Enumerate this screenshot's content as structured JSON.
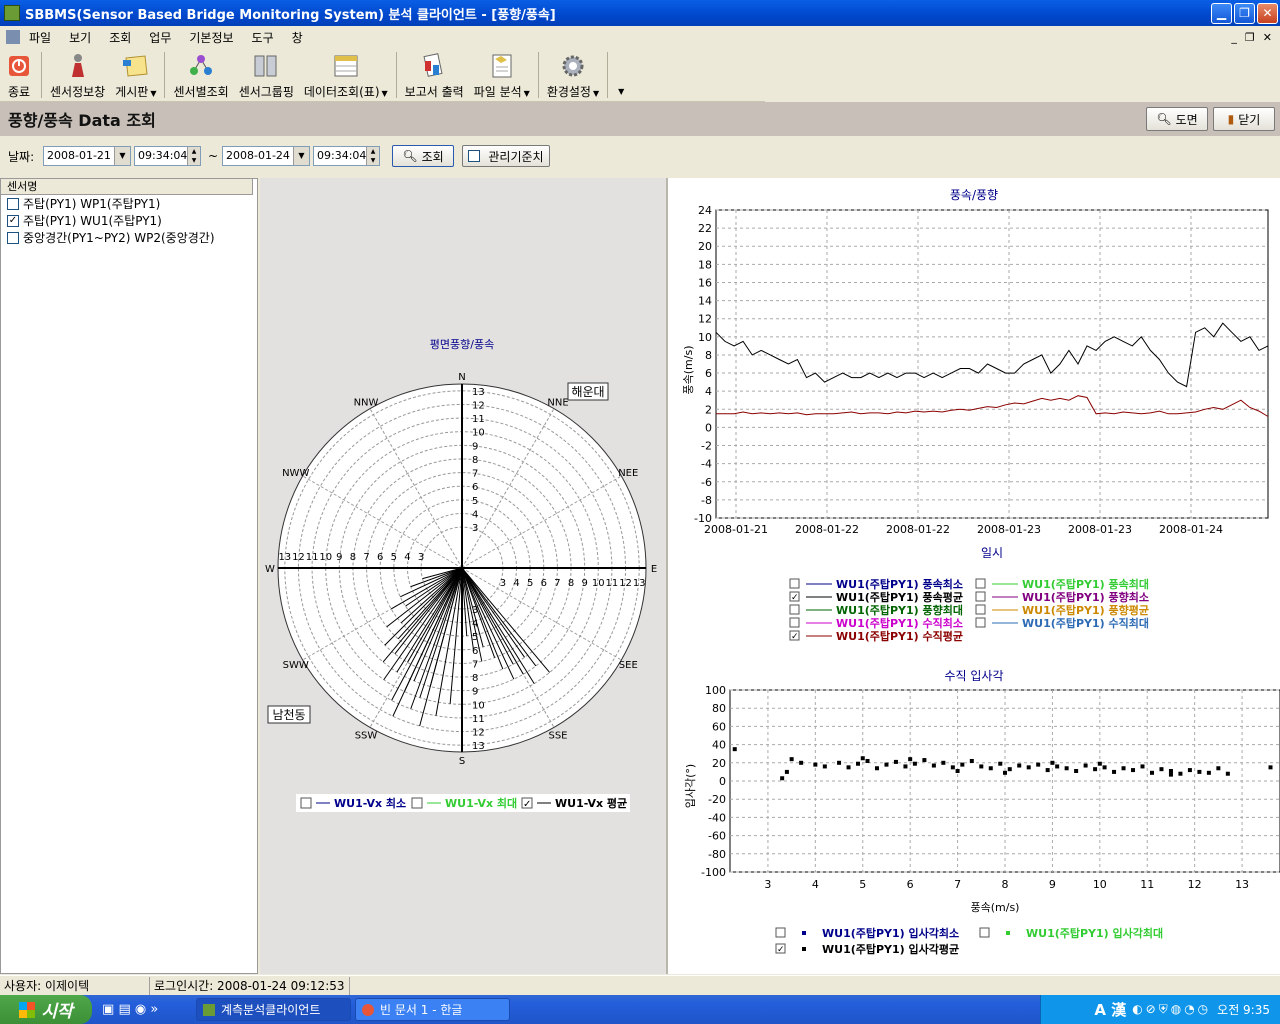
{
  "window": {
    "title": "SBBMS(Sensor Based Bridge Monitoring System) 분석 클라이언트 - [풍향/풍속]"
  },
  "menu": [
    "파일",
    "보기",
    "조회",
    "업무",
    "기본정보",
    "도구",
    "창"
  ],
  "toolbar": {
    "exit": "종료",
    "sensor_info": "센서정보창",
    "board": "게시판",
    "sensor_query": "센서별조회",
    "sensor_group": "센서그룹핑",
    "data_table": "데이터조회(표)",
    "report": "보고서 출력",
    "file_analysis": "파일 분석",
    "settings": "환경설정"
  },
  "page": {
    "title": "풍향/풍속 Data 조회",
    "map_btn": "도면",
    "close_btn": "닫기"
  },
  "filter": {
    "date_label": "날짜:",
    "start_date": "2008-01-21",
    "start_time": "09:34:04",
    "tilde": "~",
    "end_date": "2008-01-24",
    "end_time": "09:34:04",
    "query_btn": "조회",
    "mgmt_label": "관리기준치"
  },
  "sensors": {
    "header": "센서명",
    "items": [
      {
        "label": "주탑(PY1) WP1(주탑PY1)",
        "checked": false
      },
      {
        "label": "주탑(PY1) WU1(주탑PY1)",
        "checked": true
      },
      {
        "label": "중앙경간(PY1~PY2) WP2(중앙경간)",
        "checked": false
      }
    ]
  },
  "polar": {
    "title": "평면풍향/풍속",
    "directions": [
      "N",
      "NNE",
      "NEE",
      "E",
      "SEE",
      "SSE",
      "S",
      "SSW",
      "SWW",
      "W",
      "NWW",
      "NNW"
    ],
    "ring_labels": [
      "3",
      "4",
      "5",
      "6",
      "7",
      "8",
      "9",
      "10",
      "11",
      "12",
      "13"
    ],
    "annotations": [
      "해운대",
      "남천동"
    ],
    "legend": [
      {
        "label": "WU1-Vx 최소",
        "checked": false,
        "color": "#00008B"
      },
      {
        "label": "WU1-Vx 최대",
        "checked": false,
        "color": "#33CC33"
      },
      {
        "label": "WU1-Vx 평균",
        "checked": true,
        "color": "#000000"
      }
    ]
  },
  "chart_data": [
    {
      "type": "line",
      "title": "풍속/풍향",
      "xlabel": "일시",
      "ylabel": "풍속(m/s)",
      "ylim": [
        -10,
        24
      ],
      "y_ticks": [
        "24",
        "22",
        "20",
        "18",
        "16",
        "14",
        "12",
        "10",
        "8",
        "6",
        "4",
        "2",
        "0",
        "-2",
        "-4",
        "-6",
        "-8",
        "-10"
      ],
      "x_tick_labels": [
        "2008-01-21",
        "2008-01-22",
        "2008-01-22",
        "2008-01-23",
        "2008-01-23",
        "2008-01-24"
      ],
      "grid": true,
      "series": [
        {
          "name": "WU1(주탑PY1) 풍속평균",
          "color": "#000000",
          "values": [
            10.5,
            9.5,
            9.0,
            9.5,
            8.0,
            8.5,
            8.0,
            7.5,
            7.0,
            7.5,
            5.5,
            6.0,
            5.0,
            5.5,
            6.0,
            5.5,
            5.5,
            6.0,
            5.5,
            6.0,
            5.5,
            6.0,
            6.0,
            5.5,
            6.0,
            5.5,
            6.0,
            6.5,
            6.5,
            6.0,
            7.0,
            6.5,
            6.0,
            6.0,
            7.0,
            7.5,
            8.0,
            6.0,
            7.0,
            8.5,
            7.0,
            9.0,
            8.5,
            9.5,
            10.0,
            9.5,
            9.0,
            10.0,
            8.5,
            7.5,
            6.0,
            5.0,
            4.5,
            10.5,
            11.0,
            10.0,
            11.5,
            10.5,
            9.5,
            10.0,
            8.5,
            9.0
          ]
        },
        {
          "name": "WU1(주탑PY1) 수직평균",
          "color": "#8B0000",
          "values": [
            1.5,
            1.5,
            1.5,
            1.7,
            1.5,
            1.6,
            1.5,
            1.6,
            1.5,
            1.6,
            1.4,
            1.5,
            1.5,
            1.5,
            1.6,
            1.7,
            1.5,
            1.6,
            1.6,
            1.5,
            1.7,
            1.6,
            1.8,
            1.7,
            1.8,
            1.7,
            1.9,
            2.0,
            1.9,
            2.1,
            2.3,
            2.2,
            2.5,
            2.7,
            2.6,
            2.9,
            3.2,
            3.0,
            3.2,
            3.0,
            3.5,
            3.3,
            1.5,
            1.6,
            1.5,
            1.7,
            1.6,
            1.5,
            1.6,
            1.8,
            1.5,
            1.5,
            1.6,
            1.7,
            2.0,
            2.2,
            2.0,
            2.5,
            3.0,
            2.2,
            1.8,
            1.2
          ]
        }
      ],
      "legend": [
        {
          "label": "WU1(주탑PY1) 풍속최소",
          "checked": false,
          "color": "#00008B"
        },
        {
          "label": "WU1(주탑PY1) 풍속최대",
          "checked": false,
          "color": "#33CC33"
        },
        {
          "label": "WU1(주탑PY1) 풍속평균",
          "checked": true,
          "color": "#000000"
        },
        {
          "label": "WU1(주탑PY1) 풍향최소",
          "checked": false,
          "color": "#800080"
        },
        {
          "label": "WU1(주탑PY1) 풍향최대",
          "checked": false,
          "color": "#006400"
        },
        {
          "label": "WU1(주탑PY1) 풍향평균",
          "checked": false,
          "color": "#CC8800"
        },
        {
          "label": "WU1(주탑PY1) 수직최소",
          "checked": false,
          "color": "#CC00CC"
        },
        {
          "label": "WU1(주탑PY1) 수직최대",
          "checked": false,
          "color": "#2E6BB5"
        },
        {
          "label": "WU1(주탑PY1) 수직평균",
          "checked": true,
          "color": "#8B0000"
        }
      ]
    },
    {
      "type": "scatter",
      "title": "수직 입사각",
      "xlabel": "풍속(m/s)",
      "ylabel": "입사각(°)",
      "xlim": [
        2.2,
        13.8
      ],
      "ylim": [
        -100,
        100
      ],
      "x_ticks": [
        "3",
        "4",
        "5",
        "6",
        "7",
        "8",
        "9",
        "10",
        "11",
        "12",
        "13"
      ],
      "y_ticks": [
        "100",
        "80",
        "60",
        "40",
        "20",
        "0",
        "-20",
        "-40",
        "-60",
        "-80",
        "-100"
      ],
      "grid": true,
      "series": [
        {
          "name": "WU1(주탑PY1) 입사각평균",
          "color": "#000000",
          "x": [
            2.3,
            3.3,
            3.5,
            3.7,
            4.0,
            4.2,
            4.5,
            4.7,
            4.9,
            5.1,
            5.3,
            5.5,
            5.7,
            5.9,
            6.1,
            6.3,
            6.5,
            6.7,
            6.9,
            7.1,
            7.3,
            7.5,
            7.7,
            7.9,
            8.1,
            8.3,
            8.5,
            8.7,
            8.9,
            9.1,
            9.3,
            9.5,
            9.7,
            9.9,
            10.1,
            10.3,
            10.5,
            10.7,
            10.9,
            11.1,
            11.3,
            11.5,
            11.7,
            11.9,
            12.1,
            12.3,
            12.5,
            12.7,
            13.6,
            3.4,
            5.0,
            6.0,
            7.0,
            8.0,
            9.0,
            10.0,
            11.5
          ],
          "y": [
            35,
            3,
            24,
            20,
            18,
            16,
            20,
            15,
            19,
            22,
            14,
            18,
            21,
            16,
            19,
            23,
            17,
            20,
            15,
            18,
            22,
            16,
            14,
            19,
            13,
            17,
            15,
            18,
            12,
            16,
            14,
            11,
            17,
            13,
            15,
            10,
            14,
            12,
            16,
            9,
            13,
            11,
            8,
            12,
            10,
            9,
            14,
            8,
            15,
            10,
            25,
            24,
            11,
            9,
            20,
            19,
            7
          ]
        }
      ],
      "legend": [
        {
          "label": "WU1(주탑PY1) 입사각최소",
          "checked": false,
          "color": "#00008B"
        },
        {
          "label": "WU1(주탑PY1) 입사각최대",
          "checked": false,
          "color": "#33CC33"
        },
        {
          "label": "WU1(주탑PY1) 입사각평균",
          "checked": true,
          "color": "#000000"
        }
      ]
    },
    {
      "type": "scatter",
      "title": "평면풍향/풍속",
      "note": "polar: angle in degrees clockwise from N, r = wind speed",
      "series": [
        {
          "name": "WU1-Vx 평균",
          "color": "#000000",
          "angle": [
            185,
            190,
            195,
            198,
            200,
            203,
            205,
            208,
            210,
            212,
            215,
            218,
            220,
            222,
            225,
            228,
            232,
            236,
            240,
            245,
            250,
            255,
            160,
            158,
            155,
            152,
            150,
            148,
            145,
            143,
            140,
            165,
            168,
            172,
            176,
            180,
            195,
            205
          ],
          "r": [
            10,
            11,
            12,
            10,
            11,
            9,
            10,
            11,
            8,
            9,
            10,
            8,
            9,
            7,
            8,
            6,
            7,
            5,
            6,
            5,
            4,
            3,
            7,
            8,
            9,
            8,
            9,
            10,
            8,
            9,
            10,
            6,
            7,
            6,
            5,
            4,
            9,
            12
          ]
        }
      ]
    }
  ],
  "status": {
    "user": "사용자: 이제이텍",
    "login_time": "로그인시간: 2008-01-24 09:12:53"
  },
  "taskbar": {
    "start": "시작",
    "tasks": [
      "계측분석클라이언트",
      "빈 문서 1 - 한글"
    ],
    "ime": "A 漢",
    "clock": "오전 9:35"
  }
}
